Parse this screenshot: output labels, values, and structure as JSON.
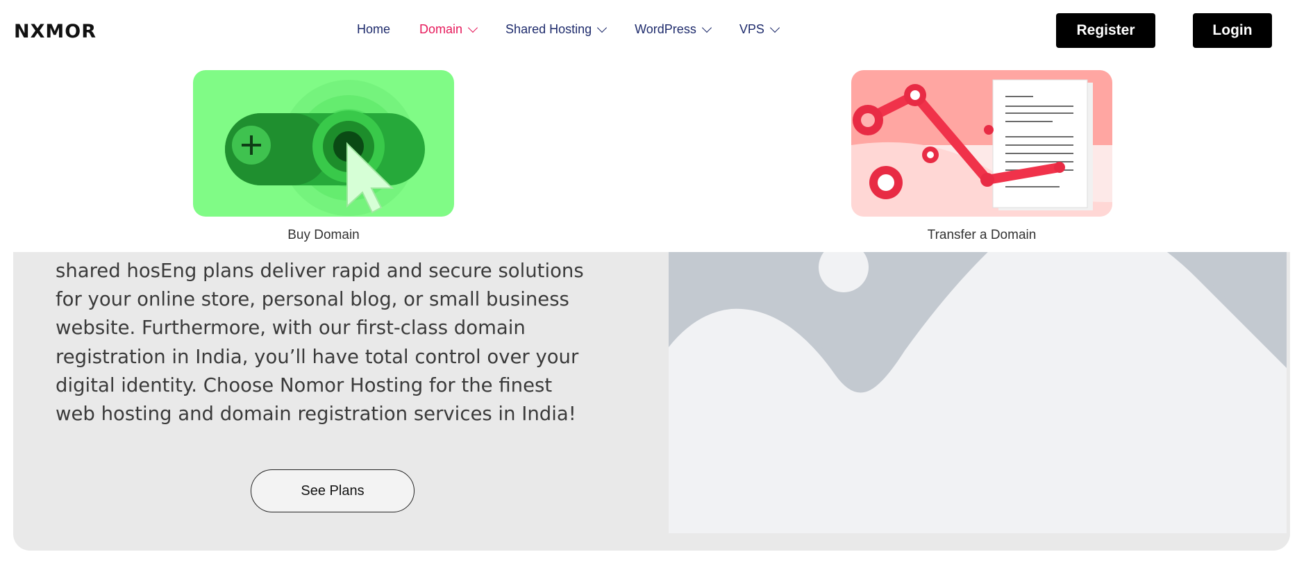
{
  "brand": {
    "logo_text": "NXMOR"
  },
  "nav": {
    "items": [
      {
        "label": "Home",
        "has_dropdown": false,
        "active": false
      },
      {
        "label": "Domain",
        "has_dropdown": true,
        "active": true
      },
      {
        "label": "Shared Hosting",
        "has_dropdown": true,
        "active": false
      },
      {
        "label": "WordPress",
        "has_dropdown": true,
        "active": false
      },
      {
        "label": "VPS",
        "has_dropdown": true,
        "active": false
      }
    ]
  },
  "header_actions": {
    "register_label": "Register",
    "login_label": "Login"
  },
  "domain_menu": {
    "items": [
      {
        "label": "Buy Domain",
        "icon": "cursor-toggle-illustration"
      },
      {
        "label": "Transfer a Domain",
        "icon": "robot-arm-document-illustration"
      }
    ]
  },
  "main": {
    "description": "shared hosEng plans deliver rapid and secure solutions for your online store, personal blog, or small business website. Furthermore, with our first-class domain registration in India, you’ll have total control over your digital identity. Choose Nomor Hosting for the finest web hosting and domain registration services in India!",
    "cta_label": "See Plans",
    "image_icon": "image-placeholder"
  },
  "colors": {
    "nav_text": "#1d2a6b",
    "nav_active": "#e6185a",
    "button_bg": "#000000",
    "card_bg": "#e9e9e9",
    "buy_domain_bg": "#80fb86",
    "transfer_bg": "#ffa6a2"
  }
}
